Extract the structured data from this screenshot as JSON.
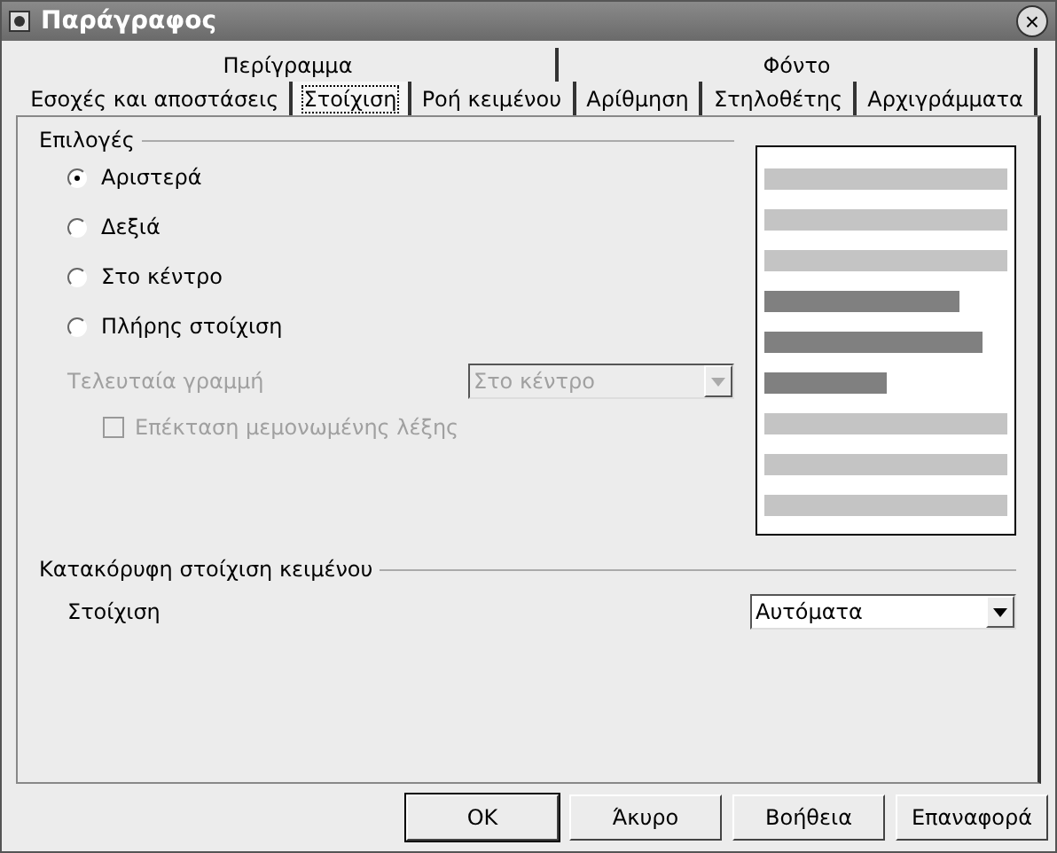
{
  "window": {
    "title": "Παράγραφος",
    "close": "×"
  },
  "tab_rows": [
    [
      {
        "label": "Περίγραμμα",
        "selected": false
      },
      {
        "label": "Φόντο",
        "selected": false
      }
    ],
    [
      {
        "label": "Εσοχές και αποστάσεις",
        "selected": false
      },
      {
        "label": "Στοίχιση",
        "selected": true
      },
      {
        "label": "Ροή κειμένου",
        "selected": false
      },
      {
        "label": "Αρίθμηση",
        "selected": false
      },
      {
        "label": "Στηλοθέτης",
        "selected": false
      },
      {
        "label": "Αρχιγράμματα",
        "selected": false
      }
    ]
  ],
  "options": {
    "title": "Επιλογές",
    "radios": [
      {
        "label": "Αριστερά",
        "selected": true
      },
      {
        "label": "Δεξιά",
        "selected": false
      },
      {
        "label": "Στο κέντρο",
        "selected": false
      },
      {
        "label": "Πλήρης στοίχιση",
        "selected": false
      }
    ],
    "last_line": {
      "label": "Τελευταία γραμμή",
      "value": "Στο κέντρο",
      "disabled": true
    },
    "expand_word": {
      "label": "Επέκταση μεμονωμένης λέξης",
      "checked": false,
      "disabled": true
    }
  },
  "vertical": {
    "title": "Κατακόρυφη στοίχιση κειμένου",
    "label": "Στοίχιση",
    "value": "Αυτόματα",
    "disabled": false
  },
  "buttons": [
    {
      "label": "OK",
      "default": true
    },
    {
      "label": "Άκυρο",
      "default": false
    },
    {
      "label": "Βοήθεια",
      "default": false
    },
    {
      "label": "Επαναφορά",
      "default": false
    }
  ]
}
